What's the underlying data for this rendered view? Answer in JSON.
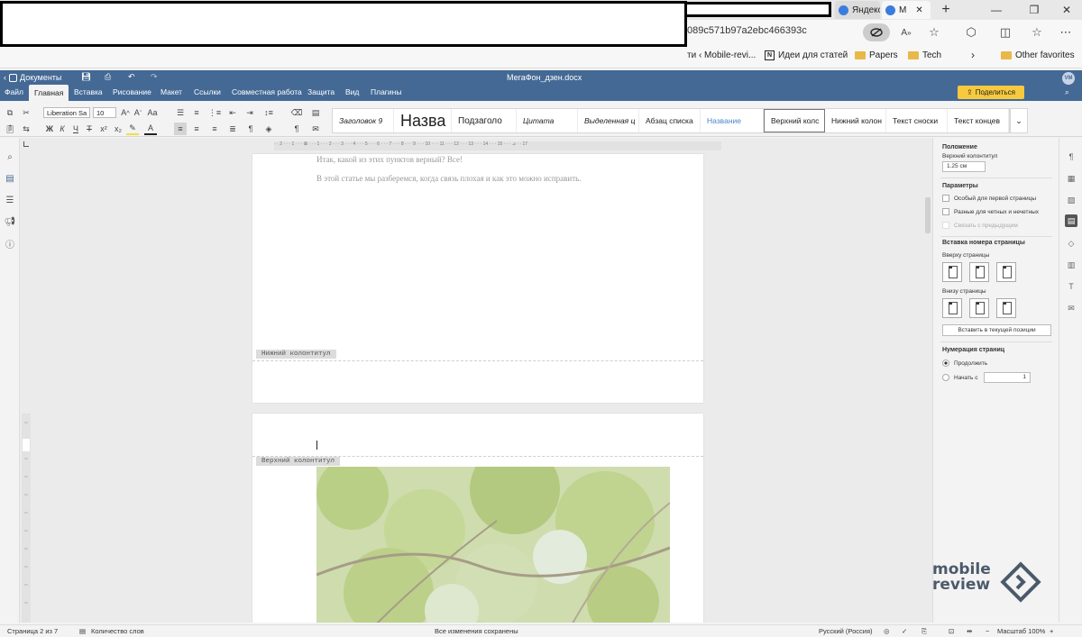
{
  "browser": {
    "tabs": [
      {
        "label": "Яндекс"
      },
      {
        "label": "M"
      }
    ],
    "address_tail": "089c571b97a2ebc466393c",
    "bookmarks": [
      {
        "label": "ти ‹ Mobile-revi..."
      },
      {
        "label": "Идеи для статей",
        "icon": "notion-icon"
      },
      {
        "label": "Papers",
        "icon": "folder-icon"
      },
      {
        "label": "Tech",
        "icon": "folder-icon"
      },
      {
        "label": "Other favorites",
        "icon": "folder-icon"
      }
    ]
  },
  "app": {
    "back_label": "Документы",
    "doc_title": "МегаФон_дзен.docx",
    "avatar": "VM",
    "share_label": "Поделиться",
    "menu": [
      "Файл",
      "Главная",
      "Вставка",
      "Рисование",
      "Макет",
      "Ссылки",
      "Совместная работа",
      "Защита",
      "Вид",
      "Плагины"
    ]
  },
  "toolbar": {
    "font_name": "Liberation Sa",
    "font_size": "10",
    "styles": [
      "Заголовок 9",
      "Назва",
      "Подзаголо",
      "Цитата",
      "Выделенная ц",
      "Абзац списка",
      "Название",
      "Верхний колс",
      "Нижний колон",
      "Текст сноски",
      "Текст концев"
    ]
  },
  "document": {
    "ruler_ticks": "· · 2 · · · 1 · · · ⊠ · · · 1 · · · 2 · · · 3 · · · 4 · · · 5 · · · 6 · · · 7 · · · 8 · · · 9 · · · 10 · · · 11 · · · 12 · · · 13 · · · 14 · · · 15 · · · ⊿ · · 17",
    "line1": "Итак, какой из этих пунктов верный? Все!",
    "line2": "В этой статье мы разберемся, когда связь плохая и как это можно исправить.",
    "footer_label": "Нижний колонтитул",
    "header_label": "Верхний колонтитул"
  },
  "right_panel": {
    "position_head": "Положение",
    "header_dist_label": "Верхний колонтитул",
    "header_dist_value": "1.25 см",
    "params_head": "Параметры",
    "opt_first": "Особый для первой страницы",
    "opt_odd_even": "Разные для четных и нечетных",
    "opt_link_prev": "Связать с предыдущим",
    "page_num_insert_head": "Вставка номера страницы",
    "top_of_page": "Вверху страницы",
    "bottom_of_page": "Внизу страницы",
    "insert_current": "Вставить в текущей позиции",
    "numbering_head": "Нумерация страниц",
    "continue_label": "Продолжить",
    "start_with_label": "Начать с",
    "start_with_value": "1"
  },
  "status": {
    "page_info": "Страница 2 из 7",
    "word_count": "Количество слов",
    "saved": "Все изменения сохранены",
    "language": "Русский (Россия)",
    "zoom": "Масштаб 100%"
  },
  "watermark": {
    "line1": "mobile",
    "line2": "review"
  },
  "colors": {
    "app_header": "#446995",
    "share": "#f7c93e"
  }
}
